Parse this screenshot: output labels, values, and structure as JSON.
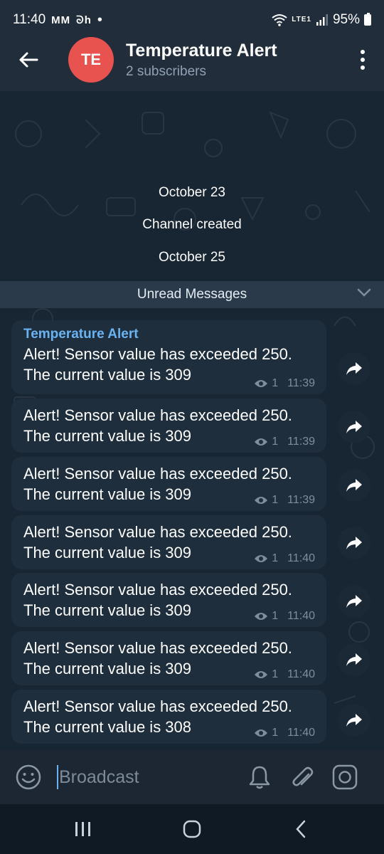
{
  "status_bar": {
    "time": "11:40",
    "notif_icons": "MM",
    "small_icon": "ᘐh",
    "dot": "•",
    "network": "LTE1",
    "battery": "95%"
  },
  "header": {
    "avatar_initials": "TE",
    "avatar_color": "#e9534f",
    "title": "Temperature Alert",
    "subtitle": "2 subscribers"
  },
  "chat": {
    "service_messages": [
      "October 23",
      "Channel created",
      "October 25"
    ],
    "unread_label": "Unread Messages",
    "messages": [
      {
        "sender": "Temperature Alert",
        "text": "Alert! Sensor value has exceeded 250. The current value is 309",
        "views": "1",
        "time": "11:39"
      },
      {
        "sender": "",
        "text": "Alert! Sensor value has exceeded 250. The current value is 309",
        "views": "1",
        "time": "11:39"
      },
      {
        "sender": "",
        "text": "Alert! Sensor value has exceeded 250. The current value is 309",
        "views": "1",
        "time": "11:39"
      },
      {
        "sender": "",
        "text": "Alert! Sensor value has exceeded 250. The current value is 309",
        "views": "1",
        "time": "11:40"
      },
      {
        "sender": "",
        "text": "Alert! Sensor value has exceeded 250. The current value is 309",
        "views": "1",
        "time": "11:40"
      },
      {
        "sender": "",
        "text": "Alert! Sensor value has exceeded 250. The current value is 309",
        "views": "1",
        "time": "11:40"
      },
      {
        "sender": "",
        "text": "Alert! Sensor value has exceeded 250. The current value is 308",
        "views": "1",
        "time": "11:40"
      }
    ]
  },
  "input_bar": {
    "placeholder": "Broadcast"
  },
  "colors": {
    "accent": "#6ab3f3",
    "header_bg": "#212d3b",
    "bubble_bg": "#1f2e3d"
  }
}
